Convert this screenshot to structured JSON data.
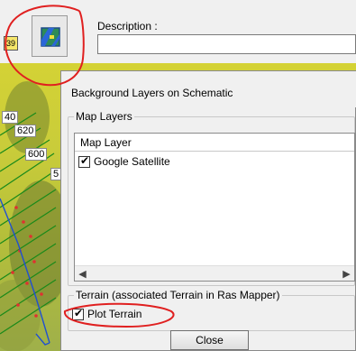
{
  "toolbar": {
    "left_icon_text": "39",
    "map_button_icon": "map-layers-icon",
    "description_label": "Description :",
    "description_value": ""
  },
  "map": {
    "labels": [
      "40",
      "620",
      "600",
      "5"
    ]
  },
  "dialog": {
    "title": "Background Layers on Schematic",
    "map_layers_group": "Map Layers",
    "list_header": "Map Layer",
    "layers": [
      {
        "label": "Google Satellite",
        "checked": true
      }
    ],
    "terrain_group": "Terrain (associated Terrain in Ras Mapper)",
    "plot_terrain_label": "Plot Terrain",
    "plot_terrain_checked": true,
    "close_label": "Close"
  },
  "colors": {
    "annotation": "#e02020",
    "map_base": "#cfcf3a",
    "grid_lines": "#1a8a1a",
    "points": "#e03030",
    "river": "#2050d0"
  }
}
